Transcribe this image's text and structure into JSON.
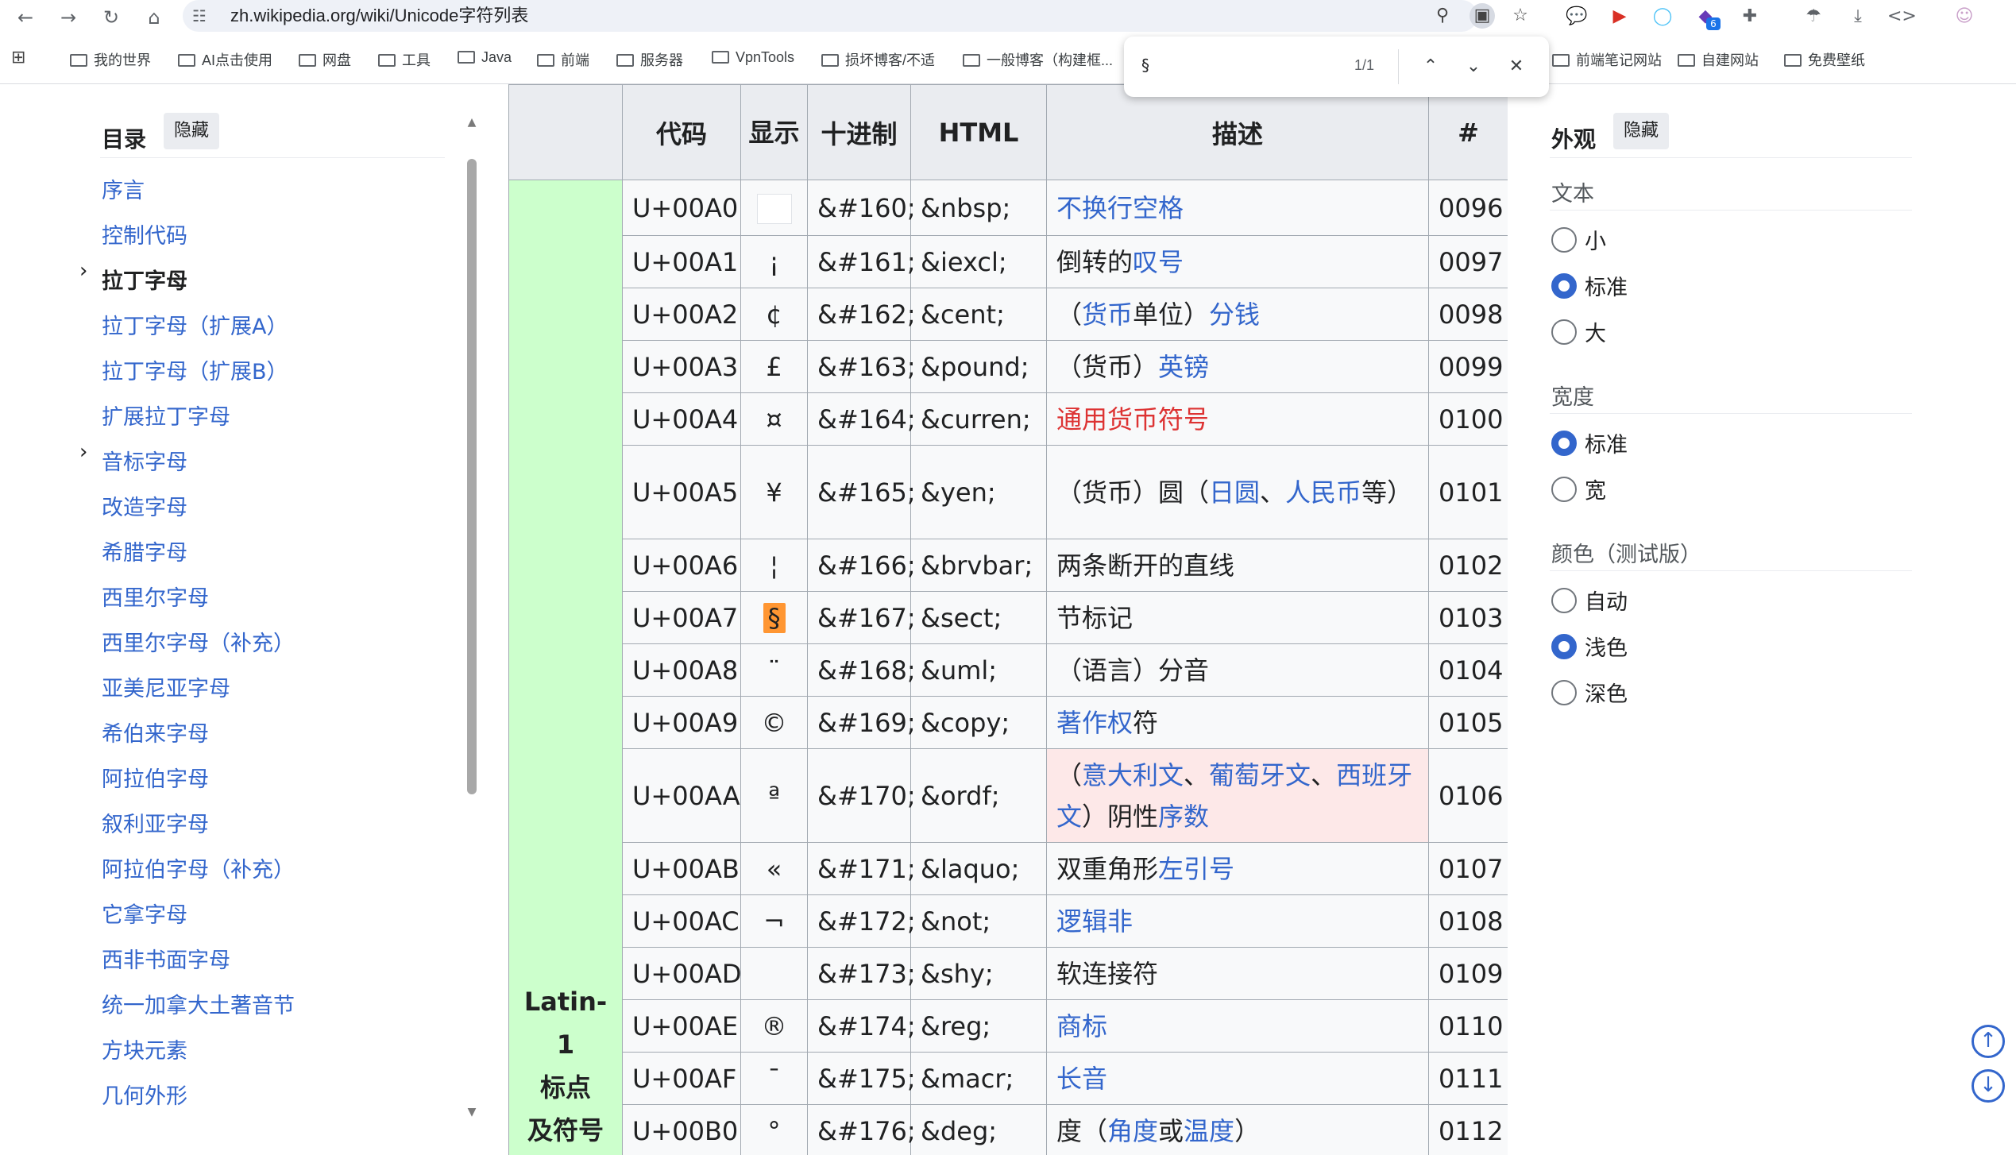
{
  "browser": {
    "url": "zh.wikipedia.org/wiki/Unicode字符列表",
    "bookmarks": [
      "我的世界",
      "AI点击使用",
      "网盘",
      "工具",
      "Java",
      "前端",
      "服务器",
      "VpnTools",
      "损坏博客/不适",
      "一般博客（构建框...",
      "前端笔记网站",
      "自建网站",
      "免费壁纸"
    ],
    "ext_badge": "6"
  },
  "findbar": {
    "query": "§",
    "count": "1/1"
  },
  "toc": {
    "title": "目录",
    "hide_label": "隐藏",
    "items": [
      "序言",
      "控制代码",
      "拉丁字母",
      "拉丁字母（扩展A）",
      "拉丁字母（扩展B）",
      "扩展拉丁字母",
      "音标字母",
      "改造字母",
      "希腊字母",
      "西里尔字母",
      "西里尔字母（补充）",
      "亚美尼亚字母",
      "希伯来字母",
      "阿拉伯字母",
      "叙利亚字母",
      "阿拉伯字母（补充）",
      "它拿字母",
      "西非书面字母",
      "统一加拿大土著音节",
      "方块元素",
      "几何外形"
    ],
    "current_index": 2
  },
  "table": {
    "headers": [
      "",
      "代码",
      "显示",
      "十进制",
      "HTML",
      "描述",
      "#"
    ],
    "category": "Latin-1 标点 及符号",
    "category_lines": [
      "Latin-1",
      "标点",
      "及符号"
    ],
    "rows": [
      {
        "code": "U+00A0",
        "disp": "",
        "dec": "&#160;",
        "html": "&nbsp;",
        "desc": [
          {
            "t": "不换行空格",
            "l": "link"
          }
        ],
        "num": "0096"
      },
      {
        "code": "U+00A1",
        "disp": "¡",
        "dec": "&#161;",
        "html": "&iexcl;",
        "desc": [
          {
            "t": "倒转的",
            "l": ""
          },
          {
            "t": "叹号",
            "l": "link"
          }
        ],
        "num": "0097"
      },
      {
        "code": "U+00A2",
        "disp": "¢",
        "dec": "&#162;",
        "html": "&cent;",
        "desc": [
          {
            "t": "（",
            "l": ""
          },
          {
            "t": "货币",
            "l": "link"
          },
          {
            "t": "单位）",
            "l": ""
          },
          {
            "t": "分钱",
            "l": "link"
          }
        ],
        "num": "0098"
      },
      {
        "code": "U+00A3",
        "disp": "£",
        "dec": "&#163;",
        "html": "&pound;",
        "desc": [
          {
            "t": "（货币）",
            "l": ""
          },
          {
            "t": "英镑",
            "l": "link"
          }
        ],
        "num": "0099"
      },
      {
        "code": "U+00A4",
        "disp": "¤",
        "dec": "&#164;",
        "html": "&curren;",
        "desc": [
          {
            "t": "通用货币符号",
            "l": "red"
          }
        ],
        "num": "0100"
      },
      {
        "code": "U+00A5",
        "disp": "¥",
        "dec": "&#165;",
        "html": "&yen;",
        "desc": [
          {
            "t": "（货币）圆（",
            "l": ""
          },
          {
            "t": "日圆",
            "l": "link"
          },
          {
            "t": "、",
            "l": ""
          },
          {
            "t": "人民币",
            "l": "link"
          },
          {
            "t": "等）",
            "l": ""
          }
        ],
        "num": "0101"
      },
      {
        "code": "U+00A6",
        "disp": "¦",
        "dec": "&#166;",
        "html": "&brvbar;",
        "desc": [
          {
            "t": "两条断开的直线",
            "l": ""
          }
        ],
        "num": "0102"
      },
      {
        "code": "U+00A7",
        "disp": "§",
        "dec": "&#167;",
        "html": "&sect;",
        "desc": [
          {
            "t": "节标记",
            "l": ""
          }
        ],
        "num": "0103"
      },
      {
        "code": "U+00A8",
        "disp": "¨",
        "dec": "&#168;",
        "html": "&uml;",
        "desc": [
          {
            "t": "（语言）分音",
            "l": ""
          }
        ],
        "num": "0104"
      },
      {
        "code": "U+00A9",
        "disp": "©",
        "dec": "&#169;",
        "html": "&copy;",
        "desc": [
          {
            "t": "著作权",
            "l": "link"
          },
          {
            "t": "符",
            "l": ""
          }
        ],
        "num": "0105"
      },
      {
        "code": "U+00AA",
        "disp": "ª",
        "dec": "&#170;",
        "html": "&ordf;",
        "desc": [
          {
            "t": "（",
            "l": ""
          },
          {
            "t": "意大利文",
            "l": "link"
          },
          {
            "t": "、",
            "l": ""
          },
          {
            "t": "葡萄牙文",
            "l": "link"
          },
          {
            "t": "、",
            "l": ""
          },
          {
            "t": "西班牙文",
            "l": "link"
          },
          {
            "t": "）阴性",
            "l": ""
          },
          {
            "t": "序数",
            "l": "link"
          }
        ],
        "num": "0106"
      },
      {
        "code": "U+00AB",
        "disp": "«",
        "dec": "&#171;",
        "html": "&laquo;",
        "desc": [
          {
            "t": "双重角形",
            "l": ""
          },
          {
            "t": "左引号",
            "l": "link"
          }
        ],
        "num": "0107"
      },
      {
        "code": "U+00AC",
        "disp": "¬",
        "dec": "&#172;",
        "html": "&not;",
        "desc": [
          {
            "t": "逻辑非",
            "l": "link"
          }
        ],
        "num": "0108"
      },
      {
        "code": "U+00AD",
        "disp": "",
        "dec": "&#173;",
        "html": "&shy;",
        "desc": [
          {
            "t": "软连接符",
            "l": ""
          }
        ],
        "num": "0109"
      },
      {
        "code": "U+00AE",
        "disp": "®",
        "dec": "&#174;",
        "html": "&reg;",
        "desc": [
          {
            "t": "商标",
            "l": "link"
          }
        ],
        "num": "0110"
      },
      {
        "code": "U+00AF",
        "disp": "¯",
        "dec": "&#175;",
        "html": "&macr;",
        "desc": [
          {
            "t": "长音",
            "l": "link"
          }
        ],
        "num": "0111"
      },
      {
        "code": "U+00B0",
        "disp": "°",
        "dec": "&#176;",
        "html": "&deg;",
        "desc": [
          {
            "t": "度（",
            "l": ""
          },
          {
            "t": "角度",
            "l": "link"
          },
          {
            "t": "或",
            "l": ""
          },
          {
            "t": "温度",
            "l": "link"
          },
          {
            "t": "）",
            "l": ""
          }
        ],
        "num": "0112"
      }
    ]
  },
  "appearance": {
    "title": "外观",
    "hide_label": "隐藏",
    "text_label": "文本",
    "text_options": [
      "小",
      "标准",
      "大"
    ],
    "text_selected": 1,
    "width_label": "宽度",
    "width_options": [
      "标准",
      "宽"
    ],
    "width_selected": 0,
    "color_label": "颜色（测试版）",
    "color_options": [
      "自动",
      "浅色",
      "深色"
    ],
    "color_selected": 1
  },
  "colors": {
    "link": "#3366cc",
    "redlink": "#dd3333",
    "category_bg": "#ccffcc",
    "highlight": "#ff9632"
  }
}
